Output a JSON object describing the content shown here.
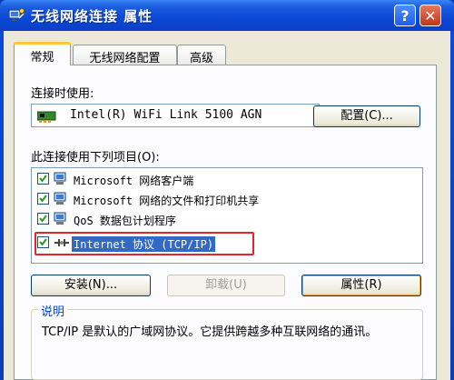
{
  "window": {
    "title": "无线网络连接 属性",
    "help_label": "?",
    "close_label": "✕"
  },
  "tabs": [
    {
      "label": "常规",
      "active": true
    },
    {
      "label": "无线网络配置",
      "active": false
    },
    {
      "label": "高级",
      "active": false
    }
  ],
  "connect_using": {
    "label": "连接时使用:",
    "adapter": "Intel(R) WiFi Link 5100 AGN",
    "configure_button": "配置(C)..."
  },
  "components": {
    "label": "此连接使用下列项目(O):",
    "items": [
      {
        "label": "Microsoft 网络客户端",
        "checked": true,
        "icon": "network-client-icon"
      },
      {
        "label": "Microsoft 网络的文件和打印机共享",
        "checked": true,
        "icon": "file-printer-sharing-icon"
      },
      {
        "label": "QoS 数据包计划程序",
        "checked": true,
        "icon": "qos-scheduler-icon"
      },
      {
        "label": "Internet 协议 (TCP/IP)",
        "checked": true,
        "icon": "protocol-icon",
        "selected": true
      }
    ]
  },
  "buttons": {
    "install": "安装(N)...",
    "uninstall": "卸载(U)",
    "properties": "属性(R)"
  },
  "description": {
    "title": "说明",
    "text": "TCP/IP 是默认的广域网协议。它提供跨越多种互联网络的通讯。"
  },
  "colors": {
    "titlebar": "#0a48d6",
    "selection": "#316ac5",
    "highlight_frame": "#e0262c"
  }
}
